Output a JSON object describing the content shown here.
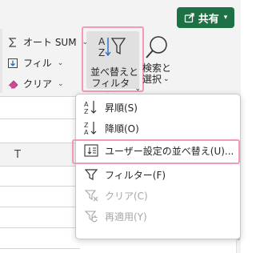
{
  "share": {
    "label": "共有",
    "icon": "share-icon"
  },
  "ribbon": {
    "autosum_label": "オート SUM",
    "fill_label": "フィル",
    "clear_label": "クリア",
    "sort_filter_label_line1": "並べ替えと",
    "sort_filter_label_line2": "フィルター",
    "find_label_line1": "検索と",
    "find_label_line2": "選択"
  },
  "sheet": {
    "column_letter": "T"
  },
  "menu": {
    "items": [
      {
        "label": "昇順(S)",
        "icon": "sort-ascending-icon",
        "enabled": true
      },
      {
        "label": "降順(O)",
        "icon": "sort-descending-icon",
        "enabled": true
      },
      {
        "label": "ユーザー設定の並べ替え(U)...",
        "icon": "custom-sort-icon",
        "enabled": true
      },
      {
        "label": "フィルター(F)",
        "icon": "filter-icon",
        "enabled": true
      },
      {
        "label": "クリア(C)",
        "icon": "clear-filter-icon",
        "enabled": false
      },
      {
        "label": "再適用(Y)",
        "icon": "reapply-icon",
        "enabled": false
      }
    ]
  },
  "colors": {
    "share_bg": "#1e7145",
    "highlight": "#f29ab8",
    "disabled": "#a6a6a6"
  }
}
